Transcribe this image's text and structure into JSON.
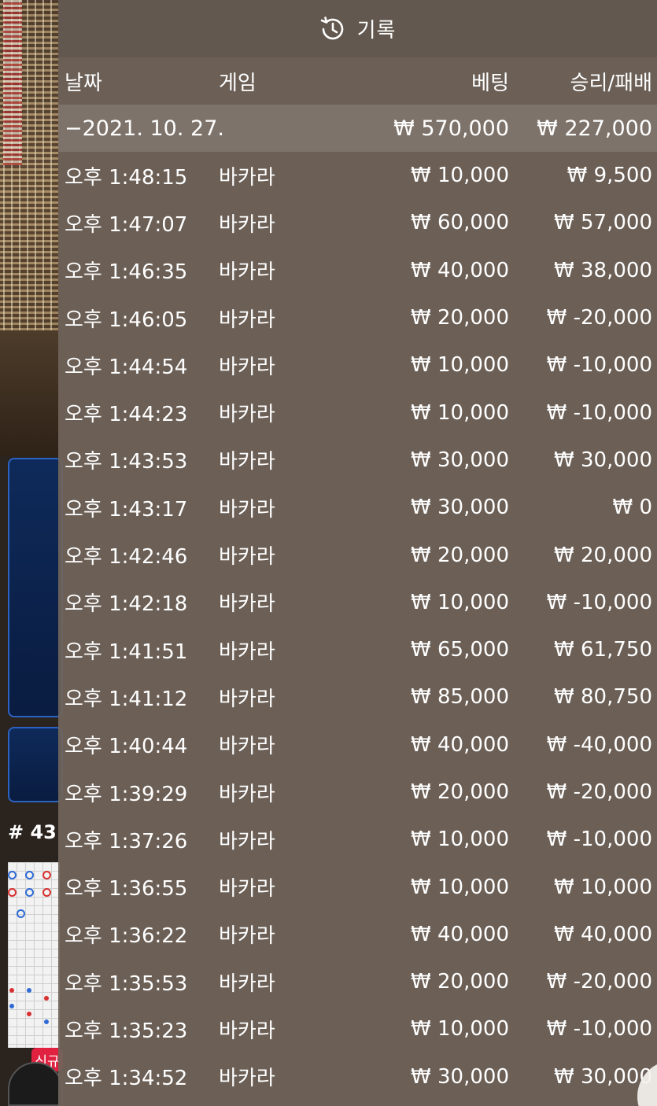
{
  "header": {
    "title": "기록",
    "icon": "history-icon"
  },
  "columns": {
    "date": "날짜",
    "game": "게임",
    "bet": "베팅",
    "result": "승리/패배"
  },
  "group": {
    "date": "−2021. 10. 27.",
    "bet_total": "₩ 570,000",
    "result_total": "₩ 227,000"
  },
  "rows": [
    {
      "time": "오후 1:48:15",
      "game": "바카라",
      "bet": "₩ 10,000",
      "result": "₩ 9,500"
    },
    {
      "time": "오후 1:47:07",
      "game": "바카라",
      "bet": "₩ 60,000",
      "result": "₩ 57,000"
    },
    {
      "time": "오후 1:46:35",
      "game": "바카라",
      "bet": "₩ 40,000",
      "result": "₩ 38,000"
    },
    {
      "time": "오후 1:46:05",
      "game": "바카라",
      "bet": "₩ 20,000",
      "result": "₩ -20,000"
    },
    {
      "time": "오후 1:44:54",
      "game": "바카라",
      "bet": "₩ 10,000",
      "result": "₩ -10,000"
    },
    {
      "time": "오후 1:44:23",
      "game": "바카라",
      "bet": "₩ 10,000",
      "result": "₩ -10,000"
    },
    {
      "time": "오후 1:43:53",
      "game": "바카라",
      "bet": "₩ 30,000",
      "result": "₩ 30,000"
    },
    {
      "time": "오후 1:43:17",
      "game": "바카라",
      "bet": "₩ 30,000",
      "result": "₩ 0"
    },
    {
      "time": "오후 1:42:46",
      "game": "바카라",
      "bet": "₩ 20,000",
      "result": "₩ 20,000"
    },
    {
      "time": "오후 1:42:18",
      "game": "바카라",
      "bet": "₩ 10,000",
      "result": "₩ -10,000"
    },
    {
      "time": "오후 1:41:51",
      "game": "바카라",
      "bet": "₩ 65,000",
      "result": "₩ 61,750"
    },
    {
      "time": "오후 1:41:12",
      "game": "바카라",
      "bet": "₩ 85,000",
      "result": "₩ 80,750"
    },
    {
      "time": "오후 1:40:44",
      "game": "바카라",
      "bet": "₩ 40,000",
      "result": "₩ -40,000"
    },
    {
      "time": "오후 1:39:29",
      "game": "바카라",
      "bet": "₩ 20,000",
      "result": "₩ -20,000"
    },
    {
      "time": "오후 1:37:26",
      "game": "바카라",
      "bet": "₩ 10,000",
      "result": "₩ -10,000"
    },
    {
      "time": "오후 1:36:55",
      "game": "바카라",
      "bet": "₩ 10,000",
      "result": "₩ 10,000"
    },
    {
      "time": "오후 1:36:22",
      "game": "바카라",
      "bet": "₩ 40,000",
      "result": "₩ 40,000"
    },
    {
      "time": "오후 1:35:53",
      "game": "바카라",
      "bet": "₩ 20,000",
      "result": "₩ -20,000"
    },
    {
      "time": "오후 1:35:23",
      "game": "바카라",
      "bet": "₩ 10,000",
      "result": "₩ -10,000"
    },
    {
      "time": "오후 1:34:52",
      "game": "바카라",
      "bet": "₩ 30,000",
      "result": "₩ 30,000"
    }
  ],
  "background": {
    "round_label": "# 43",
    "new_badge": "신규"
  },
  "close": {
    "icon": "close-icon"
  },
  "colors": {
    "panel_bg": "#70645a",
    "text": "#ffffff",
    "accent_blue": "#2c63c2",
    "badge_red": "#e0213f"
  }
}
